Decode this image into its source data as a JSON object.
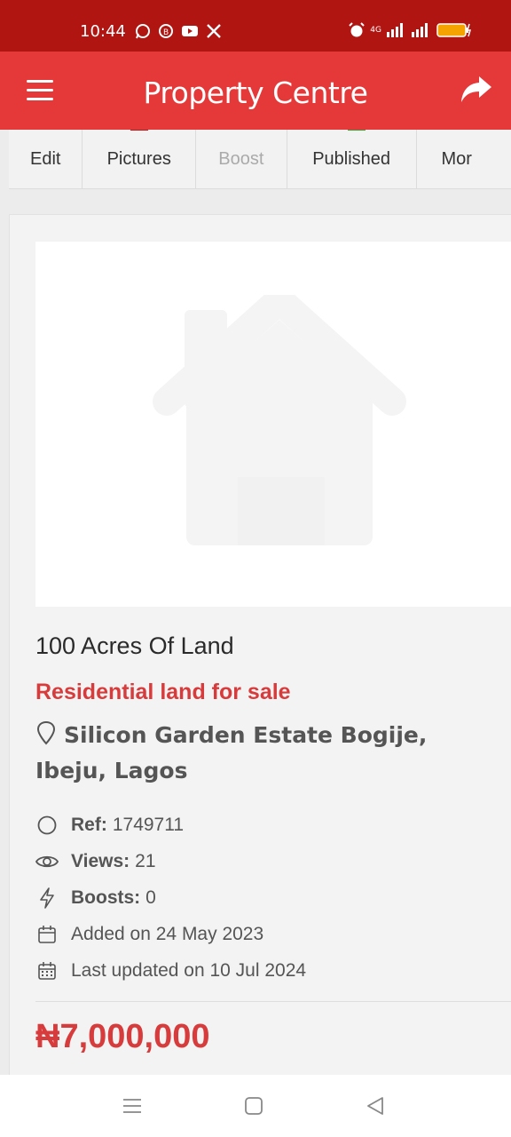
{
  "status_bar": {
    "time": "10:44",
    "network": "4G"
  },
  "app_bar": {
    "title": "Property Centre"
  },
  "tabs": [
    {
      "label": "Edit",
      "disabled": false
    },
    {
      "label": "Pictures",
      "disabled": false
    },
    {
      "label": "Boost",
      "disabled": true
    },
    {
      "label": "Published",
      "disabled": false
    },
    {
      "label": "Mor",
      "disabled": false
    }
  ],
  "listing": {
    "title": "100 Acres Of Land",
    "subtitle": "Residential land for sale",
    "location": "Silicon Garden Estate Bogije, Ibeju, Lagos",
    "ref_label": "Ref:",
    "ref_value": "1749711",
    "views_label": "Views:",
    "views_value": "21",
    "boosts_label": "Boosts:",
    "boosts_value": "0",
    "added": "Added on 24 May 2023",
    "updated": "Last updated on 10 Jul 2024",
    "price": "₦7,000,000"
  },
  "colors": {
    "status_bar": "#b01512",
    "app_bar": "#e53939",
    "accent_text": "#d73b3b"
  }
}
